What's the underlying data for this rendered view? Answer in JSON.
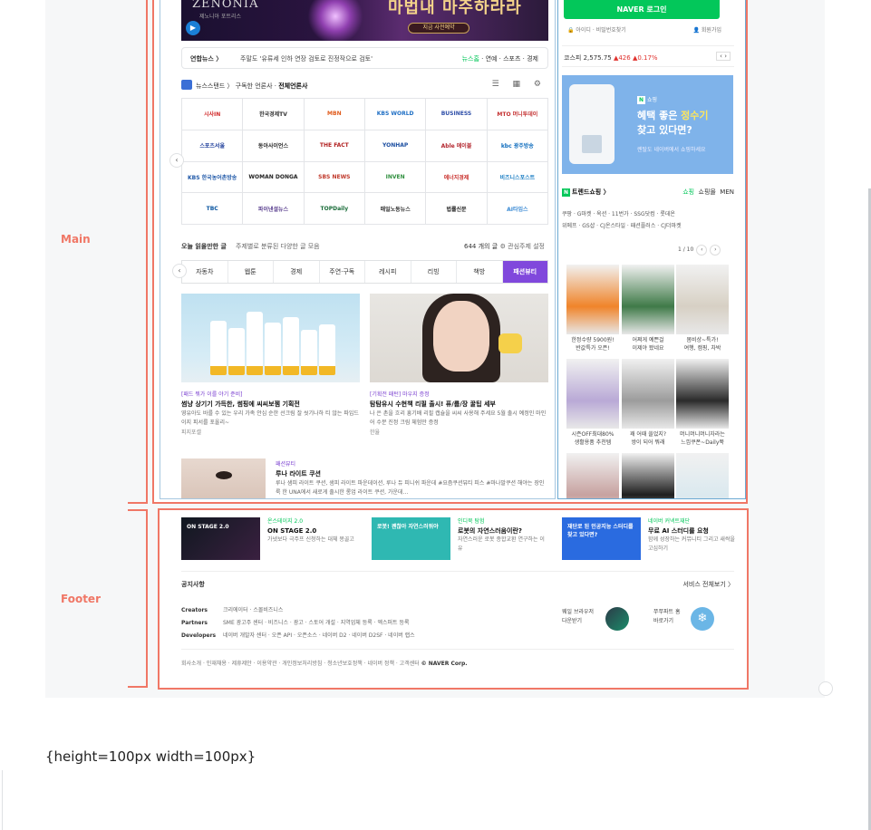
{
  "labels": {
    "main": "Main",
    "footer": "Footer"
  },
  "banner": {
    "logo": "ZENONIA",
    "sub": "제노니아 포트리스",
    "headline": "마법내 마주하라라",
    "cta": "지금 사전예약"
  },
  "ticker": {
    "source": "연합뉴스 〉",
    "text": "주말도 '유류세 인하 연장 검토로 진정작으로 검토'",
    "links": "뉴스홈 · 연예 · 스포츠 · 경제",
    "links_highlight": "뉴스홈"
  },
  "newsstand": {
    "title": "뉴스스탠드 〉 구독한 언론사 · ",
    "title_bold": "전체언론사",
    "tools": "☰ ▦ ⚙"
  },
  "press": [
    {
      "name": "시사IN",
      "color": "#d12b2b"
    },
    {
      "name": "한국경제TV",
      "color": "#333333"
    },
    {
      "name": "MBN",
      "color": "#e05a1a"
    },
    {
      "name": "KBS WORLD",
      "color": "#1f6fc4"
    },
    {
      "name": "BUSINESS",
      "color": "#2d4ea8"
    },
    {
      "name": "MTO 머니투데이",
      "color": "#c43030"
    },
    {
      "name": "스포츠서울",
      "color": "#1d3d9a"
    },
    {
      "name": "동아사이언스",
      "color": "#2a2a2a"
    },
    {
      "name": "THE FACT",
      "color": "#b22222"
    },
    {
      "name": "YONHAP",
      "color": "#1b4ea0"
    },
    {
      "name": "Able 에이블",
      "color": "#b3262e"
    },
    {
      "name": "kbc 광주방송",
      "color": "#0c6bbd"
    },
    {
      "name": "KBS 한국농어촌방송",
      "color": "#1f58a8"
    },
    {
      "name": "WOMAN DONGA",
      "color": "#222222"
    },
    {
      "name": "SBS NEWS",
      "color": "#c0392b"
    },
    {
      "name": "INVEN",
      "color": "#2f8f3e"
    },
    {
      "name": "에너지경제",
      "color": "#c9302c"
    },
    {
      "name": "비즈니스포스트",
      "color": "#1d7fc4"
    },
    {
      "name": "TBC",
      "color": "#0a55a0"
    },
    {
      "name": "파이낸셜뉴스",
      "color": "#5a3f8f"
    },
    {
      "name": "TOPDaily",
      "color": "#1b6d3a"
    },
    {
      "name": "매일노동뉴스",
      "color": "#333333"
    },
    {
      "name": "법률신문",
      "color": "#222222"
    },
    {
      "name": "AI타임스",
      "color": "#3a8ad4"
    }
  ],
  "today": {
    "title": "오늘 읽을만한 글",
    "desc": "주제별로 분류된 다양한 글 모음",
    "count": "644 개의 글",
    "setting": "⚙ 관심주제 설정"
  },
  "categories": [
    "자동차",
    "웹툰",
    "경제",
    "주연·구독",
    "레시피",
    "리빙",
    "책방",
    "패션뷰티"
  ],
  "articles": [
    {
      "tag": "[패드 뭐가 이를 야기 준비]",
      "title": "썸냥 상기기 가득한, 썸핑에 씨씨보젬 기획전",
      "body": "영유아도 바를 수 있는 우리 가족 안심 순한 선크림 잘 씻기나하 티 않는 파입드 이지 피서를 포올리~",
      "src": "피지포셀"
    },
    {
      "tag": "[기획전 패턴] 마우지 증정",
      "title": "탐탐유시 수현책 리필 출시! 퓨/룹/장 꿀팁 세부",
      "body": "나 은 촌을 흐리 흥기배 리필 캡슐을 씨씨 사용해 주세요 5월 출시 예정인 마인어 수분 진정 크림 체험만 증정",
      "src": "한율"
    },
    {
      "tag": "패션뷰티",
      "title": "루나 라이트 쿠션",
      "body": "루나 샘피 라이트 쿠션, 샘피 라이트 파운데이션, 루나 듀 피니쉬 파운데 #요즘쿠션뷰티 피스 #마나말쿠션 해야는 장인 룩 한 UNA에서 새로게 출시한 롱업 라이트 쿠션, 가운데..."
    }
  ],
  "right": {
    "login_label": "NAVER 로그인",
    "login_links": "🔒 아이디 · 비밀번호찾기",
    "login_join": "👤 회원가입",
    "stock": {
      "name": "코스피",
      "value": "2,575.75",
      "change": "▲426 ▲0.17%"
    },
    "ad": {
      "tag": "쇼핑",
      "headline_1": "혜택 좋은 ",
      "headline_hl": "정수기",
      "headline_2": "찾고 있다면?",
      "sub": "렌탈도 네이버에서 쇼핑하세요"
    },
    "shop": {
      "title": "트렌드쇼핑 〉",
      "tabs": "쇼핑 · 쇼핑몰 · MEN",
      "tabs_hl": "쇼핑",
      "tags_1": "쿠팡 · G마켓 · 옥션 · 11번가 · SSG닷컴 · 롯데온",
      "tags_2": "위메프 · GS샵 · CJ온스타일 · 패션플러스 · CJ더마켓",
      "pager": "1 / 10"
    },
    "products": [
      {
        "cap": "한정수량 5900원!\n반값특가 오픈!"
      },
      {
        "cap": "어쩌게 예쁜걸\n이제야 봤네요"
      },
      {
        "cap": "봄비샹~특가!\n여행, 캠핑, 차박"
      },
      {
        "cap": "시즌OFF최대80%\n생활용품 추천템"
      },
      {
        "cap": "꽤 어때 쓸었지?\n쌍이 되어 뭐래"
      },
      {
        "cap": "머니머니머니자라는\n느낌쿠폰~Daily쭉"
      }
    ]
  },
  "footer": {
    "cards": [
      {
        "tag": "온스테이지 2.0",
        "title": "ON STAGE 2.0",
        "desc": "가넷보다 극주프 신청하는 대체 몽골고",
        "thumb": "ON STAGE 2.0"
      },
      {
        "tag": "인디북 탐험",
        "title": "로봇의 자연스러움이란?",
        "desc": "자연스러운 로봇 종합교환 연구하는 이유",
        "thumb": "로봇! 괜찮아 자연스러워야"
      },
      {
        "tag": "네이버 커넥트재단",
        "title": "무료 AI 스터디를 요청",
        "desc": "함께 성장하는 커뮤니티 그리고 새싹을 고심하기",
        "thumb": "재단로 된 인공지능 스터디를 찾고 있다면?"
      }
    ],
    "notice": "공지사항",
    "all_services": "서비스 전체보기 〉",
    "rows": [
      {
        "label": "Creators",
        "links": "크리에이터 · 스몰비즈니스"
      },
      {
        "label": "Partners",
        "links": "SME 광고주 센터 · 비즈니스 · 광고 · 스토어 개설 · 지역업체 등록 · 엑스퍼트 등록"
      },
      {
        "label": "Developers",
        "links": "네이버 개발자 센터 · 오픈 API · 오픈소스 · 네이버 D2 · 네이버 D2SF · 네이버 랩스"
      }
    ],
    "app1": "웨일 브라우저\n다운받기",
    "app2": "쭈쭈파트 홈\n바로가기",
    "bottom": "회사소개 · 인재채용 · 제휴제안 · 이용약관 · 개인정보처리방침 · 청소년보호정책 · 네이버 정책 · 고객센터 ",
    "copyright": "© NAVER Corp."
  },
  "note": "{height=100px width=100px}"
}
